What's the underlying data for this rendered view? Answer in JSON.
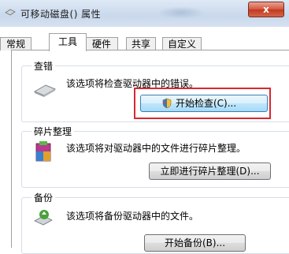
{
  "window": {
    "title": "可移动磁盘(",
    "title_suffix": ") 属性",
    "close_label": "x"
  },
  "tabs": [
    {
      "label": "常规",
      "active": false
    },
    {
      "label": "工具",
      "active": true
    },
    {
      "label": "硬件",
      "active": false
    },
    {
      "label": "共享",
      "active": false
    },
    {
      "label": "自定义",
      "active": false
    }
  ],
  "error_check": {
    "group_label": "查错",
    "description": "该选项将检查驱动器中的错误。",
    "button_label": "开始检查(C)...",
    "icon": "drive-icon"
  },
  "defrag": {
    "group_label": "碎片整理",
    "description": "该选项将对驱动器中的文件进行碎片整理。",
    "button_label": "立即进行碎片整理(D)...",
    "icon": "defrag-icon"
  },
  "backup": {
    "group_label": "备份",
    "description": "该选项将备份驱动器中的文件。",
    "button_label": "开始备份(B)...",
    "icon": "backup-icon"
  },
  "colors": {
    "highlight": "#d8282f",
    "close_button": "#c0391f"
  }
}
